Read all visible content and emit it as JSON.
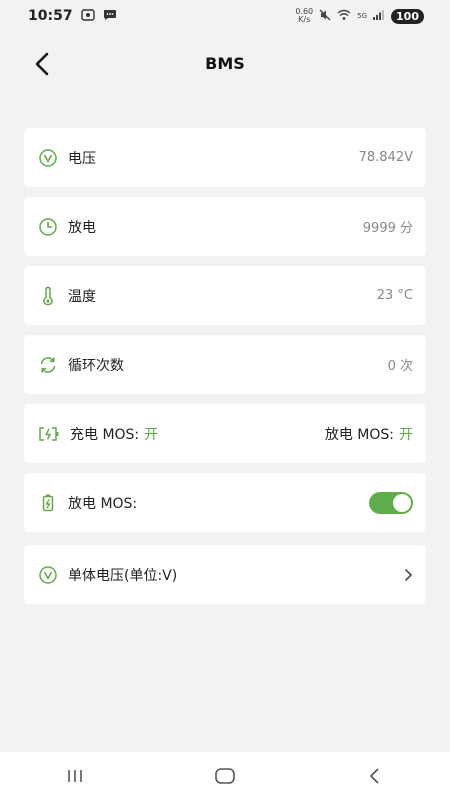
{
  "status_bar": {
    "time": "10:57",
    "net_speed_value": "0.60",
    "net_speed_unit": "K/s",
    "network": "5G",
    "battery": "100"
  },
  "header": {
    "title": "BMS"
  },
  "rows": {
    "voltage": {
      "label": "电压",
      "value": "78.842V"
    },
    "discharge": {
      "label": "放电",
      "value": "9999 分"
    },
    "temperature": {
      "label": "温度",
      "value": "23 °C"
    },
    "cycles": {
      "label": "循环次数",
      "value": "0 次"
    },
    "mos": {
      "charge_label": "充电 MOS:",
      "charge_state": "开",
      "discharge_label": "放电 MOS:",
      "discharge_state": "开"
    },
    "discharge_mos": {
      "label": "放电 MOS:",
      "enabled": true
    },
    "cell_voltage": {
      "label": "单体电压(单位:V)"
    }
  },
  "colors": {
    "accent": "#5fac4b",
    "background": "#f2f2f5",
    "card": "#ffffff"
  }
}
